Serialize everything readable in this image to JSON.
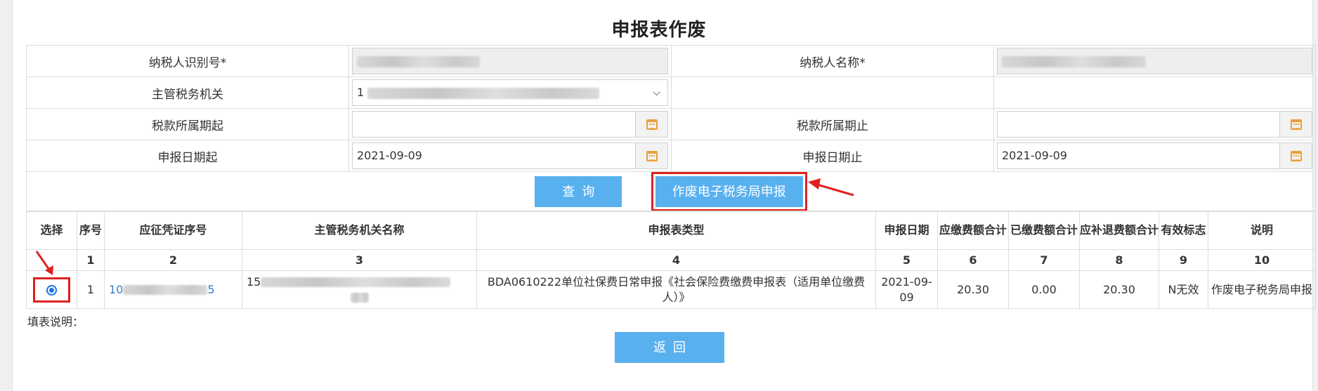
{
  "page": {
    "title": "申报表作废"
  },
  "form": {
    "taxpayer_id_label": "纳税人识别号*",
    "taxpayer_name_label": "纳税人名称*",
    "tax_authority_label": "主管税务机关",
    "tax_authority_value_visible": "1",
    "period_start_label": "税款所属期起",
    "period_end_label": "税款所属期止",
    "period_start_value": "",
    "period_end_value": "",
    "declare_date_start_label": "申报日期起",
    "declare_date_end_label": "申报日期止",
    "declare_date_start_value": "2021-09-09",
    "declare_date_end_value": "2021-09-09"
  },
  "buttons": {
    "query": "查询",
    "void_declaration": "作废电子税务局申报",
    "back": "返回"
  },
  "table": {
    "headers": [
      "选择",
      "序号",
      "应征凭证序号",
      "主管税务机关名称",
      "申报表类型",
      "申报日期",
      "应缴费额合计",
      "已缴费额合计",
      "应补退费额合计",
      "有效标志",
      "说明"
    ],
    "column_numbers": [
      "",
      "1",
      "2",
      "3",
      "4",
      "5",
      "6",
      "7",
      "8",
      "9",
      "10"
    ],
    "rows": [
      {
        "selected": true,
        "seq": "1",
        "voucher_prefix": "10",
        "voucher_suffix": "5",
        "authority_prefix": "15",
        "report_type": "BDA0610222单位社保费日常申报《社会保险费缴费申报表（适用单位缴费人）》",
        "declare_date": "2021-09-09",
        "payable_total": "20.30",
        "paid_total": "0.00",
        "refund_total": "20.30",
        "valid_flag": "N无效",
        "remark": "作废电子税务局申报"
      }
    ]
  },
  "footer": {
    "fill_note": "填表说明："
  },
  "colors": {
    "button_blue": "#58b0ef",
    "highlight_red": "#e02020",
    "calendar_orange": "#e8a03a"
  }
}
